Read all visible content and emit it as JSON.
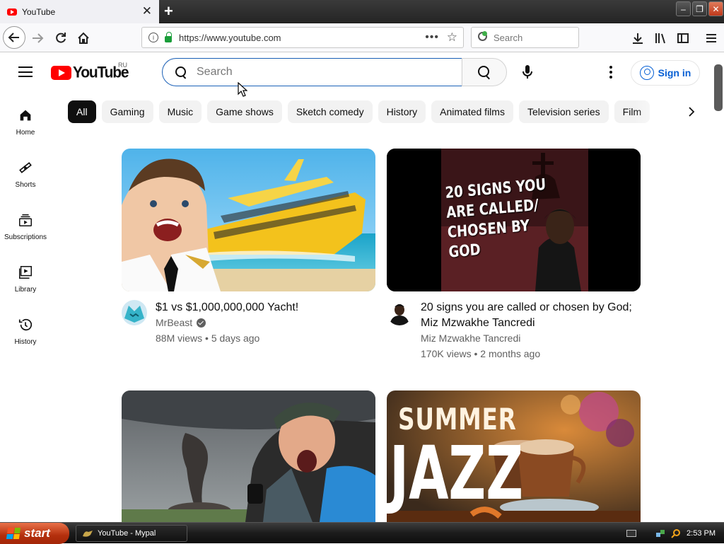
{
  "browser": {
    "tab_title": "YouTube",
    "url": "https://www.youtube.com",
    "search_placeholder": "Search"
  },
  "youtube": {
    "logo_text": "YouTube",
    "country_code": "RU",
    "search_placeholder": "Search",
    "sign_in": "Sign in",
    "sidebar": [
      {
        "label": "Home",
        "icon": "home-icon"
      },
      {
        "label": "Shorts",
        "icon": "shorts-icon"
      },
      {
        "label": "Subscriptions",
        "icon": "subscriptions-icon"
      },
      {
        "label": "Library",
        "icon": "library-icon"
      },
      {
        "label": "History",
        "icon": "history-icon"
      }
    ],
    "chips": [
      "All",
      "Gaming",
      "Music",
      "Game shows",
      "Sketch comedy",
      "History",
      "Animated films",
      "Television series",
      "Film"
    ],
    "videos": [
      {
        "title": "$1 vs $1,000,000,000 Yacht!",
        "channel": "MrBeast",
        "verified": true,
        "views": "88M views",
        "age": "5 days ago",
        "thumb_icon": "yacht-thumbnail"
      },
      {
        "title": "20 signs you are called or chosen by God; Miz Mzwakhe Tancredi",
        "channel": "Miz Mzwakhe Tancredi",
        "verified": false,
        "views": "170K views",
        "age": "2 months ago",
        "thumb_text": "20 SIGNS YOU ARE CALLED/ CHOSEN BY GOD"
      },
      {
        "title": "",
        "thumb_icon": "tornado-thumbnail"
      },
      {
        "title": "",
        "thumb_text_1": "SUMMER",
        "thumb_text_2": "JAZZ"
      }
    ]
  },
  "taskbar": {
    "start_label": "start",
    "window_item": "YouTube - Mypal",
    "clock": "2:53 PM"
  },
  "colors": {
    "youtube_red": "#ff0000",
    "link_blue": "#065fd4",
    "search_focus": "#1c62b9",
    "xp_start": "#c0391b"
  }
}
